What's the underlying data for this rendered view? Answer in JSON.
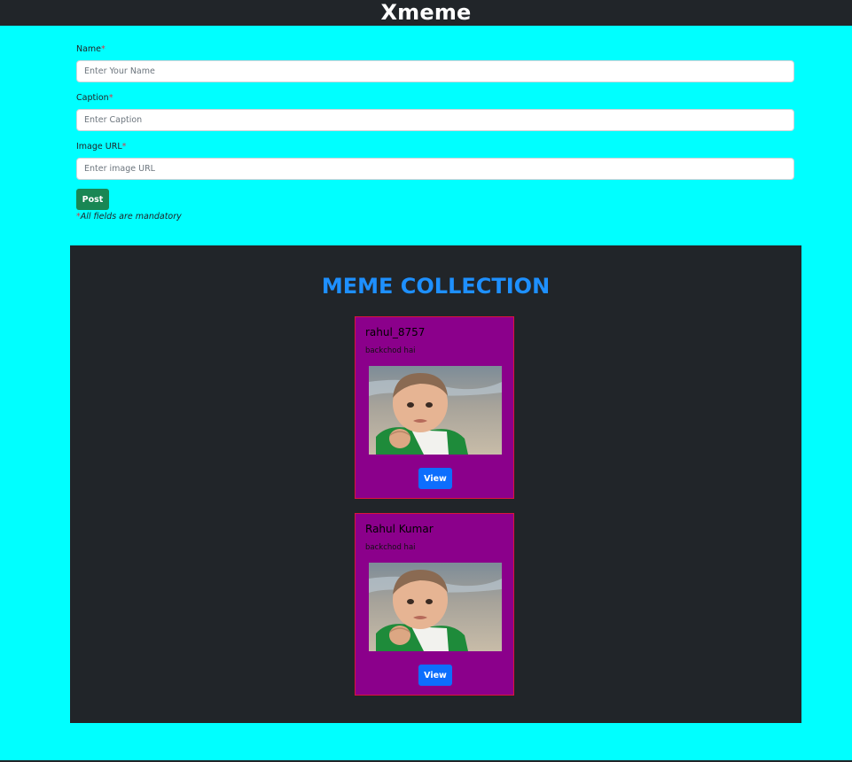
{
  "app": {
    "title": "Xmeme"
  },
  "form": {
    "name_label": "Name",
    "name_placeholder": "Enter Your Name",
    "caption_label": "Caption",
    "caption_placeholder": "Enter Caption",
    "url_label": "Image URL",
    "url_placeholder": "Enter image URL",
    "required_mark": "*",
    "post_label": "Post",
    "note_text": "All fields are mandatory"
  },
  "collection": {
    "heading": "MEME COLLECTION",
    "memes": [
      {
        "author": "rahul_8757",
        "caption": "backchod hai",
        "view_label": "View"
      },
      {
        "author": "Rahul Kumar",
        "caption": "backchod hai",
        "view_label": "View"
      }
    ]
  },
  "colors": {
    "page_bg": "#00ffff",
    "navbar_bg": "#212529",
    "section_bg": "#212529",
    "heading": "#1e90ff",
    "card_bg": "#8b008b",
    "card_border": "#dc143c",
    "post_button": "#198754",
    "view_button": "#0d6efd"
  }
}
